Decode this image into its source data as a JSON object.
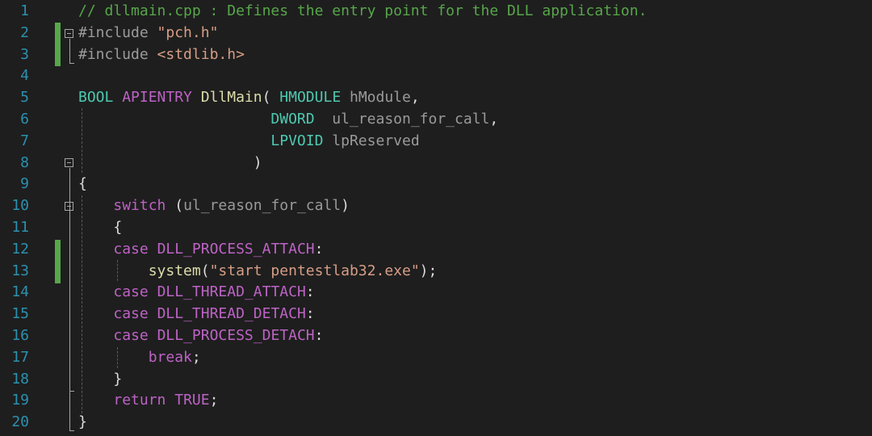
{
  "colors": {
    "background": "#1e1e1e",
    "line_number": "#2b91af",
    "comment": "#57a64a",
    "keyword": "#569cd6",
    "preprocessor": "#9b9b9b",
    "string": "#d69d85",
    "type": "#4ec9b0",
    "function": "#dcdcaa",
    "parameter": "#9a9a9a",
    "macro": "#bd63c5",
    "punct": "#dcdcdc",
    "change_marker": "#57a64a"
  },
  "lines": [
    {
      "n": "1",
      "tokens": [
        {
          "t": "// dllmain.cpp : Defines the entry point for the DLL application.",
          "c": "comment"
        }
      ]
    },
    {
      "n": "2",
      "tokens": [
        {
          "t": "#include ",
          "c": "preprocessor"
        },
        {
          "t": "\"pch.h\"",
          "c": "string"
        }
      ]
    },
    {
      "n": "3",
      "tokens": [
        {
          "t": "#include ",
          "c": "preprocessor"
        },
        {
          "t": "<stdlib.h>",
          "c": "string"
        }
      ]
    },
    {
      "n": "4",
      "tokens": []
    },
    {
      "n": "5",
      "tokens": [
        {
          "t": "BOOL",
          "c": "type"
        },
        {
          "t": " ",
          "c": "punct"
        },
        {
          "t": "APIENTRY",
          "c": "macro"
        },
        {
          "t": " ",
          "c": "punct"
        },
        {
          "t": "DllMain",
          "c": "function"
        },
        {
          "t": "( ",
          "c": "punct"
        },
        {
          "t": "HMODULE",
          "c": "type"
        },
        {
          "t": " ",
          "c": "punct"
        },
        {
          "t": "hModule",
          "c": "parameter"
        },
        {
          "t": ",",
          "c": "punct"
        }
      ]
    },
    {
      "n": "6",
      "tokens": [
        {
          "t": "                      ",
          "c": "punct"
        },
        {
          "t": "DWORD",
          "c": "type"
        },
        {
          "t": "  ",
          "c": "punct"
        },
        {
          "t": "ul_reason_for_call",
          "c": "parameter"
        },
        {
          "t": ",",
          "c": "punct"
        }
      ]
    },
    {
      "n": "7",
      "tokens": [
        {
          "t": "                      ",
          "c": "punct"
        },
        {
          "t": "LPVOID",
          "c": "type"
        },
        {
          "t": " ",
          "c": "punct"
        },
        {
          "t": "lpReserved",
          "c": "parameter"
        }
      ]
    },
    {
      "n": "8",
      "tokens": [
        {
          "t": "                    )",
          "c": "punct"
        }
      ]
    },
    {
      "n": "9",
      "tokens": [
        {
          "t": "{",
          "c": "punct"
        }
      ]
    },
    {
      "n": "10",
      "tokens": [
        {
          "t": "    ",
          "c": "punct"
        },
        {
          "t": "switch",
          "c": "macro"
        },
        {
          "t": " (",
          "c": "punct"
        },
        {
          "t": "ul_reason_for_call",
          "c": "parameter"
        },
        {
          "t": ")",
          "c": "punct"
        }
      ]
    },
    {
      "n": "11",
      "tokens": [
        {
          "t": "    {",
          "c": "punct"
        }
      ]
    },
    {
      "n": "12",
      "tokens": [
        {
          "t": "    ",
          "c": "punct"
        },
        {
          "t": "case",
          "c": "macro"
        },
        {
          "t": " ",
          "c": "punct"
        },
        {
          "t": "DLL_PROCESS_ATTACH",
          "c": "macro"
        },
        {
          "t": ":",
          "c": "punct"
        }
      ]
    },
    {
      "n": "13",
      "tokens": [
        {
          "t": "        ",
          "c": "punct"
        },
        {
          "t": "system",
          "c": "function"
        },
        {
          "t": "(",
          "c": "punct"
        },
        {
          "t": "\"start pentestlab32.exe\"",
          "c": "string"
        },
        {
          "t": ");",
          "c": "punct"
        }
      ]
    },
    {
      "n": "14",
      "tokens": [
        {
          "t": "    ",
          "c": "punct"
        },
        {
          "t": "case",
          "c": "macro"
        },
        {
          "t": " ",
          "c": "punct"
        },
        {
          "t": "DLL_THREAD_ATTACH",
          "c": "macro"
        },
        {
          "t": ":",
          "c": "punct"
        }
      ]
    },
    {
      "n": "15",
      "tokens": [
        {
          "t": "    ",
          "c": "punct"
        },
        {
          "t": "case",
          "c": "macro"
        },
        {
          "t": " ",
          "c": "punct"
        },
        {
          "t": "DLL_THREAD_DETACH",
          "c": "macro"
        },
        {
          "t": ":",
          "c": "punct"
        }
      ]
    },
    {
      "n": "16",
      "tokens": [
        {
          "t": "    ",
          "c": "punct"
        },
        {
          "t": "case",
          "c": "macro"
        },
        {
          "t": " ",
          "c": "punct"
        },
        {
          "t": "DLL_PROCESS_DETACH",
          "c": "macro"
        },
        {
          "t": ":",
          "c": "punct"
        }
      ]
    },
    {
      "n": "17",
      "tokens": [
        {
          "t": "        ",
          "c": "punct"
        },
        {
          "t": "break",
          "c": "macro"
        },
        {
          "t": ";",
          "c": "punct"
        }
      ]
    },
    {
      "n": "18",
      "tokens": [
        {
          "t": "    }",
          "c": "punct"
        }
      ]
    },
    {
      "n": "19",
      "tokens": [
        {
          "t": "    ",
          "c": "punct"
        },
        {
          "t": "return",
          "c": "macro"
        },
        {
          "t": " ",
          "c": "punct"
        },
        {
          "t": "TRUE",
          "c": "macro"
        },
        {
          "t": ";",
          "c": "punct"
        }
      ]
    },
    {
      "n": "20",
      "tokens": [
        {
          "t": "}",
          "c": "punct"
        }
      ]
    }
  ]
}
